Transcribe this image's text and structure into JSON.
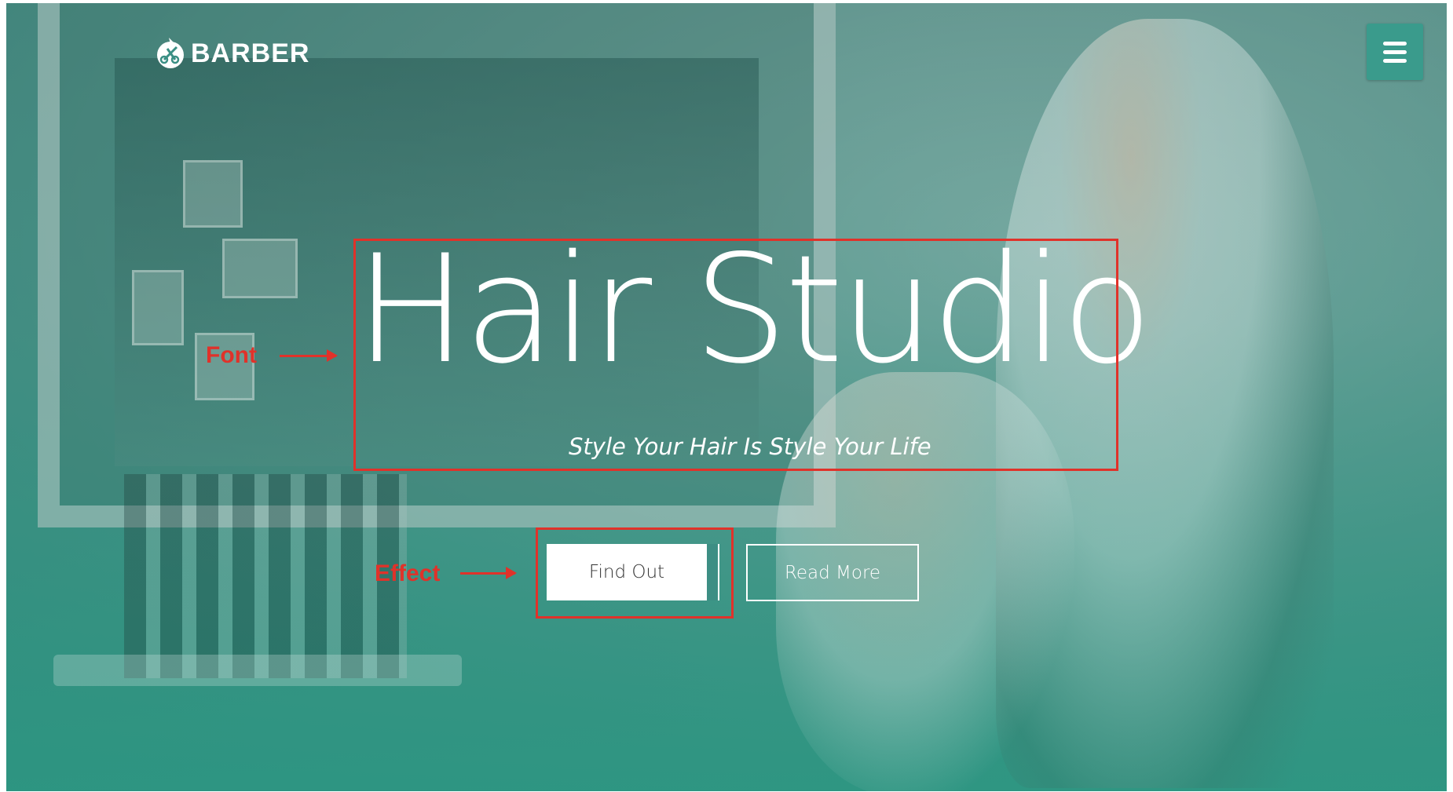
{
  "header": {
    "logo_text": "BARBER",
    "logo_icon": "scissors-comb-icon",
    "menu_icon": "hamburger-icon"
  },
  "hero": {
    "title": "Hair Studio",
    "subtitle": "Style Your Hair Is Style Your Life",
    "primary_button": "Find Out",
    "secondary_button": "Read More"
  },
  "annotations": {
    "font_label": "Font",
    "effect_label": "Effect",
    "color": "#e0322a"
  },
  "colors": {
    "accent": "#3a9b8c",
    "overlay": "#2f9684",
    "text": "#ffffff"
  }
}
